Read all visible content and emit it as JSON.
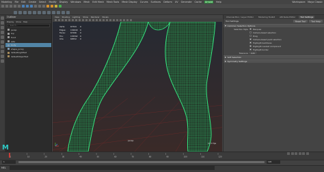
{
  "menubar": {
    "items": [
      "Modeling",
      "File",
      "Edit",
      "Create",
      "Select",
      "Modify",
      "Display",
      "Windows",
      "Mesh",
      "Edit Mesh",
      "Mesh Tools",
      "Mesh Display",
      "Curves",
      "Surfaces",
      "Deform",
      "UV",
      "Generate",
      "Cache",
      "Arnold",
      "Help"
    ],
    "accent_item": "Arnold",
    "workspace_label": "Workspace:",
    "workspace_value": "Maya Classic"
  },
  "outliner": {
    "title": "Outliner",
    "menu": [
      "Display",
      "Show",
      "Help"
    ],
    "search_placeholder": "Search...",
    "items": [
      {
        "label": "persp",
        "icon": "camera-icon",
        "selected": false
      },
      {
        "label": "top",
        "icon": "camera-icon",
        "selected": false
      },
      {
        "label": "front",
        "icon": "camera-icon",
        "selected": false
      },
      {
        "label": "side",
        "icon": "camera-icon",
        "selected": false
      },
      {
        "label": "body",
        "icon": "mesh-icon",
        "selected": true
      },
      {
        "label": "shape_proxy",
        "icon": "mesh-icon",
        "selected": false
      },
      {
        "label": "defaultLightSet",
        "icon": "set-icon",
        "selected": false
      },
      {
        "label": "defaultObjectSet",
        "icon": "set-icon",
        "selected": false
      }
    ]
  },
  "viewport": {
    "menu": [
      "View",
      "Shading",
      "Lighting",
      "Show",
      "Renderer",
      "Panels"
    ],
    "hud": [
      [
        "Verts:",
        "67344",
        "0"
      ],
      [
        "Edges:",
        "134640",
        "0"
      ],
      [
        "Faces:",
        "67296",
        "0"
      ],
      [
        "Tris:",
        "134592",
        "0"
      ],
      [
        "UVs:",
        "69552",
        "0"
      ]
    ],
    "camera_label": "persp",
    "fps": "17.3 fps",
    "wire_color": "#35e27e",
    "background_top": "#262a33",
    "background_bottom": "#3a2a28"
  },
  "attribute_editor": {
    "tabs": [
      "Channel Box / Layer Editor",
      "Modeling Toolkit",
      "Attribute Editor",
      "Tool Settings"
    ],
    "active_tab": "Tool Settings",
    "title": "Tool Settings",
    "reset_label": "Reset Tool",
    "help_label": "Tool Help",
    "sections": [
      {
        "label": "Common Selection Options",
        "open": true
      },
      {
        "label": "Soft Selection",
        "open": false
      },
      {
        "label": "Symmetry Settings",
        "open": false
      }
    ],
    "options": [
      {
        "label": "Selection Style",
        "value": "Marquee",
        "checked": true
      },
      {
        "label": "",
        "value": "Camera-based selection",
        "checked": false
      },
      {
        "label": "",
        "value": "Drag",
        "checked": false
      },
      {
        "label": "",
        "value": "Camera-based paint selection",
        "checked": true
      },
      {
        "label": "",
        "value": "Highlight backfaces",
        "checked": true
      },
      {
        "label": "",
        "value": "Highlight nearest component",
        "checked": true
      },
      {
        "label": "",
        "value": "Highlight border",
        "checked": true
      }
    ],
    "tolerance_label": "Tolerance",
    "tolerance_value": "0.00"
  },
  "timeline": {
    "start": "1",
    "end": "120",
    "current_frame": "1",
    "ticks": [
      "1",
      "10",
      "20",
      "30",
      "40",
      "50",
      "60",
      "70",
      "80",
      "90",
      "100",
      "110",
      "120"
    ]
  },
  "mel": {
    "label": "MEL"
  },
  "logo": {
    "text": "M"
  }
}
